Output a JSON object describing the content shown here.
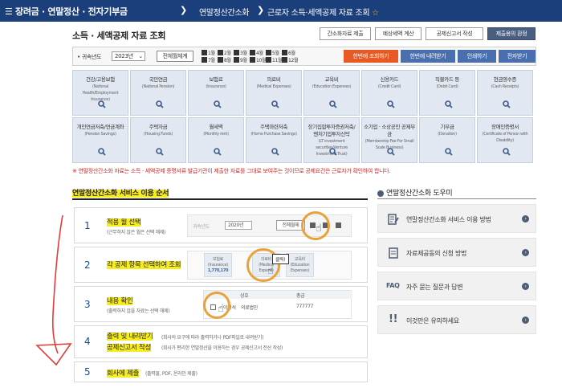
{
  "topbar": {
    "menu_icon": "hamburger-icon",
    "t1": "장려금 · 연말정산 · 전자기부금",
    "t2": "연말정산간소화",
    "t3": "근로자 소득·세액공제 자료 조회",
    "star_icon": "star-icon"
  },
  "title": "소득 · 세액공제 자료 조회",
  "top_buttons": [
    "간소화자료 제출",
    "예상세액 계산",
    "공제신고서 작성",
    "제출용의 환정"
  ],
  "filter": {
    "year_label": "귀속년도",
    "year_value": "2023년",
    "select_all": "전체월체계",
    "months_row1": [
      "1월",
      "2월",
      "3월",
      "4월",
      "5월",
      "6월"
    ],
    "months_row2": [
      "7월",
      "8월",
      "9월",
      "10월",
      "11월",
      "12월"
    ],
    "actions": [
      "한번에 조회하기",
      "한번에 내려받기",
      "인쇄하기",
      "전자받기"
    ]
  },
  "colors": {
    "topbar": "#1b3f7a",
    "action_orange": "#e85a23",
    "action_blue": "#4a6fae",
    "highlight": "#f6ec1f",
    "arrow_red": "#e23b3b",
    "ring": "#e9a23b",
    "card_bg": "#e1e8f1"
  },
  "cards_row1": [
    {
      "title": "건강/고용보험",
      "sub": "(National Health/Employment Insurance)"
    },
    {
      "title": "국민연금",
      "sub": "(National Pension)"
    },
    {
      "title": "보험료",
      "sub": "(Insurance)"
    },
    {
      "title": "의료비",
      "sub": "(Medical Expenses)"
    },
    {
      "title": "교육비",
      "sub": "(Education Expenses)"
    },
    {
      "title": "신용카드",
      "sub": "(Credit Card)"
    },
    {
      "title": "직불카드 등",
      "sub": "(Debit Card)"
    },
    {
      "title": "현금영수증",
      "sub": "(Cash Receipts)"
    }
  ],
  "cards_row2": [
    {
      "title": "개인연금저축/연금계좌",
      "sub": "(Pension Savings)"
    },
    {
      "title": "주택자금",
      "sub": "(Housing Funds)"
    },
    {
      "title": "월세액",
      "sub": "(Monthly rent)"
    },
    {
      "title": "주택마련저축",
      "sub": "(Home Purchase Savings)"
    },
    {
      "title": "장기집합투자증권저축/벤처기업투자신탁",
      "sub": "(LT investment securities/Venture Investment Trust)"
    },
    {
      "title": "소기업 · 소상공인 공제부금",
      "sub": "(Membership Fee For Small Scale Business)"
    },
    {
      "title": "기부금",
      "sub": "(Donation)"
    },
    {
      "title": "장애인증명서",
      "sub": "(Certificate of Person with Disability)"
    }
  ],
  "card_icon": "search-icon",
  "notice": "※ 연말정산간소화 자료는 소득 · 세액공제 증명서류 발급기관이 제출한 자료를 그대로 보여주는 것이므로 공제요건은 근로자가 확인하여 합니다.",
  "section_title": "연말정산간소화 서비스 이용 순서",
  "help_title": "연말정산간소화 도우미",
  "steps": [
    {
      "num": "1",
      "label": "적용 월 선택",
      "sub": "(근무하지 않은 월은 선택 해제)"
    },
    {
      "num": "2",
      "label": "각 공제 항목 선택하여 조회",
      "sub": ""
    },
    {
      "num": "3",
      "label": "내용 확인",
      "sub": "(출력하지 않을 자료는 선택 해제)"
    },
    {
      "num": "4",
      "label": "출력 및 내려받기",
      "label2": "공제신고서 작성",
      "sub": "(회사의 요구에 따라 출력하거나 PDF파일로 내려받기)",
      "sub2": "(회사가 편리한 연말정산을 이용하는 경우 공제신고서 전산 작성)"
    },
    {
      "num": "5",
      "label": "회사에 제출",
      "sub": "(출력물, PDF, 온라인 제출)"
    }
  ],
  "step_previews": {
    "s1_year_label": "귀속년도",
    "s1_year": "2020년",
    "s1_all": "전체월체",
    "s2_cards": [
      "보험료",
      "의료비",
      "교육비"
    ],
    "s2_subs": [
      "(Insurance)",
      "(Medical Expens)",
      "(Education Expenses)"
    ],
    "s2_value": "1,770,170",
    "s2_tooltip": "클릭!",
    "s3_head1": "상호",
    "s3_head2": "총금",
    "s3_row1": "이영석",
    "s3_row2": "의료법인",
    "s3_amount": "777777"
  },
  "help_items": [
    {
      "icon": "document-edit-icon",
      "label": "연말정산간소화 서비스 이용 방법"
    },
    {
      "icon": "document-icon",
      "label": "자료제공동의 신청 방법"
    },
    {
      "icon": "faq-icon",
      "label": "자주 묻는 질문과 답변",
      "prefix": "FAQ"
    },
    {
      "icon": "exclamation-icon",
      "label": "이것만은 유의하세요"
    }
  ],
  "go_icon": "chevron-right-icon"
}
